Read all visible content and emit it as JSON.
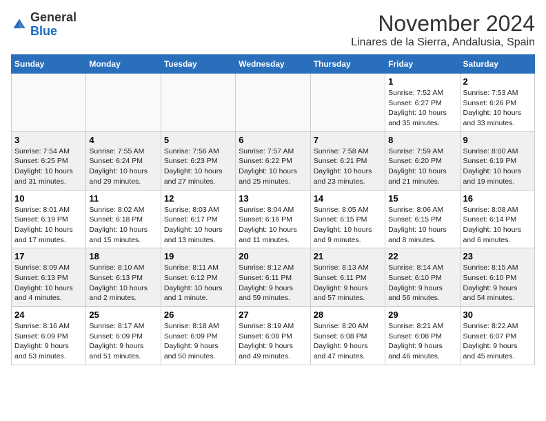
{
  "header": {
    "logo_line1": "General",
    "logo_line2": "Blue",
    "month": "November 2024",
    "location": "Linares de la Sierra, Andalusia, Spain"
  },
  "weekdays": [
    "Sunday",
    "Monday",
    "Tuesday",
    "Wednesday",
    "Thursday",
    "Friday",
    "Saturday"
  ],
  "weeks": [
    [
      {
        "day": "",
        "info": ""
      },
      {
        "day": "",
        "info": ""
      },
      {
        "day": "",
        "info": ""
      },
      {
        "day": "",
        "info": ""
      },
      {
        "day": "",
        "info": ""
      },
      {
        "day": "1",
        "info": "Sunrise: 7:52 AM\nSunset: 6:27 PM\nDaylight: 10 hours\nand 35 minutes."
      },
      {
        "day": "2",
        "info": "Sunrise: 7:53 AM\nSunset: 6:26 PM\nDaylight: 10 hours\nand 33 minutes."
      }
    ],
    [
      {
        "day": "3",
        "info": "Sunrise: 7:54 AM\nSunset: 6:25 PM\nDaylight: 10 hours\nand 31 minutes."
      },
      {
        "day": "4",
        "info": "Sunrise: 7:55 AM\nSunset: 6:24 PM\nDaylight: 10 hours\nand 29 minutes."
      },
      {
        "day": "5",
        "info": "Sunrise: 7:56 AM\nSunset: 6:23 PM\nDaylight: 10 hours\nand 27 minutes."
      },
      {
        "day": "6",
        "info": "Sunrise: 7:57 AM\nSunset: 6:22 PM\nDaylight: 10 hours\nand 25 minutes."
      },
      {
        "day": "7",
        "info": "Sunrise: 7:58 AM\nSunset: 6:21 PM\nDaylight: 10 hours\nand 23 minutes."
      },
      {
        "day": "8",
        "info": "Sunrise: 7:59 AM\nSunset: 6:20 PM\nDaylight: 10 hours\nand 21 minutes."
      },
      {
        "day": "9",
        "info": "Sunrise: 8:00 AM\nSunset: 6:19 PM\nDaylight: 10 hours\nand 19 minutes."
      }
    ],
    [
      {
        "day": "10",
        "info": "Sunrise: 8:01 AM\nSunset: 6:19 PM\nDaylight: 10 hours\nand 17 minutes."
      },
      {
        "day": "11",
        "info": "Sunrise: 8:02 AM\nSunset: 6:18 PM\nDaylight: 10 hours\nand 15 minutes."
      },
      {
        "day": "12",
        "info": "Sunrise: 8:03 AM\nSunset: 6:17 PM\nDaylight: 10 hours\nand 13 minutes."
      },
      {
        "day": "13",
        "info": "Sunrise: 8:04 AM\nSunset: 6:16 PM\nDaylight: 10 hours\nand 11 minutes."
      },
      {
        "day": "14",
        "info": "Sunrise: 8:05 AM\nSunset: 6:15 PM\nDaylight: 10 hours\nand 9 minutes."
      },
      {
        "day": "15",
        "info": "Sunrise: 8:06 AM\nSunset: 6:15 PM\nDaylight: 10 hours\nand 8 minutes."
      },
      {
        "day": "16",
        "info": "Sunrise: 8:08 AM\nSunset: 6:14 PM\nDaylight: 10 hours\nand 6 minutes."
      }
    ],
    [
      {
        "day": "17",
        "info": "Sunrise: 8:09 AM\nSunset: 6:13 PM\nDaylight: 10 hours\nand 4 minutes."
      },
      {
        "day": "18",
        "info": "Sunrise: 8:10 AM\nSunset: 6:13 PM\nDaylight: 10 hours\nand 2 minutes."
      },
      {
        "day": "19",
        "info": "Sunrise: 8:11 AM\nSunset: 6:12 PM\nDaylight: 10 hours\nand 1 minute."
      },
      {
        "day": "20",
        "info": "Sunrise: 8:12 AM\nSunset: 6:11 PM\nDaylight: 9 hours\nand 59 minutes."
      },
      {
        "day": "21",
        "info": "Sunrise: 8:13 AM\nSunset: 6:11 PM\nDaylight: 9 hours\nand 57 minutes."
      },
      {
        "day": "22",
        "info": "Sunrise: 8:14 AM\nSunset: 6:10 PM\nDaylight: 9 hours\nand 56 minutes."
      },
      {
        "day": "23",
        "info": "Sunrise: 8:15 AM\nSunset: 6:10 PM\nDaylight: 9 hours\nand 54 minutes."
      }
    ],
    [
      {
        "day": "24",
        "info": "Sunrise: 8:16 AM\nSunset: 6:09 PM\nDaylight: 9 hours\nand 53 minutes."
      },
      {
        "day": "25",
        "info": "Sunrise: 8:17 AM\nSunset: 6:09 PM\nDaylight: 9 hours\nand 51 minutes."
      },
      {
        "day": "26",
        "info": "Sunrise: 8:18 AM\nSunset: 6:09 PM\nDaylight: 9 hours\nand 50 minutes."
      },
      {
        "day": "27",
        "info": "Sunrise: 8:19 AM\nSunset: 6:08 PM\nDaylight: 9 hours\nand 49 minutes."
      },
      {
        "day": "28",
        "info": "Sunrise: 8:20 AM\nSunset: 6:08 PM\nDaylight: 9 hours\nand 47 minutes."
      },
      {
        "day": "29",
        "info": "Sunrise: 8:21 AM\nSunset: 6:08 PM\nDaylight: 9 hours\nand 46 minutes."
      },
      {
        "day": "30",
        "info": "Sunrise: 8:22 AM\nSunset: 6:07 PM\nDaylight: 9 hours\nand 45 minutes."
      }
    ]
  ]
}
